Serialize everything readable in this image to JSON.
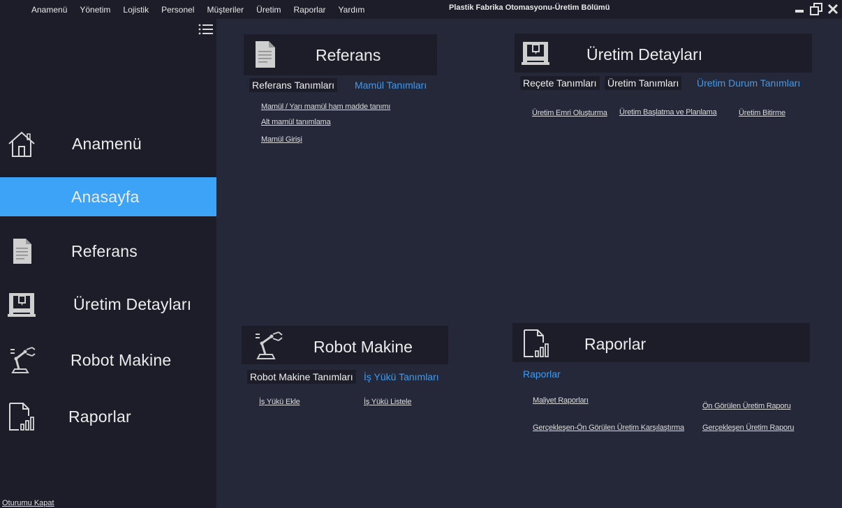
{
  "menu": [
    "Anamenü",
    "Yönetim",
    "Lojistik",
    "Personel",
    "Müşteriler",
    "Üretim",
    "Raporlar",
    "Yardım"
  ],
  "app_title": "Plastik Fabrika Otomasyonu-Üretim Bölümü",
  "window_controls": {
    "minimize": "minimize-icon",
    "restore": "restore-icon",
    "close": "close-icon"
  },
  "colors": {
    "accent": "#3da3f6",
    "sidebar": "#1c1d28",
    "background": "#252838",
    "link_blue": "#3d9bf2"
  },
  "sidebar": {
    "items": [
      {
        "label": "Anamenü",
        "icon": "home-icon"
      },
      {
        "label": "Anasayfa",
        "icon": "",
        "active": true
      },
      {
        "label": "Referans",
        "icon": "document-icon"
      },
      {
        "label": "Üretim Detayları",
        "icon": "3d-printer-icon"
      },
      {
        "label": "Robot Makine",
        "icon": "robot-arm-icon"
      },
      {
        "label": "Raporlar",
        "icon": "report-chart-icon"
      }
    ],
    "logout": "Oturumu Kapat"
  },
  "panels": {
    "referans": {
      "title": "Referans",
      "tabs": [
        "Referans Tanımları",
        "Mamül Tanımları"
      ],
      "links": [
        "Mamül / Yarı mamül ham madde tanımı",
        "Alt mamül tanımlama",
        "Mamül Girişi"
      ]
    },
    "uretim": {
      "title": "Üretim Detayları",
      "tabs": [
        "Reçete Tanımları",
        "Üretim Tanımları",
        "Üretim Durum Tanımları"
      ],
      "links": [
        "Üretim Emri Oluşturma",
        "Üretim Başlatma ve Planlama",
        "Üretim Bitirme"
      ]
    },
    "robot": {
      "title": "Robot Makine",
      "tabs": [
        "Robot Makine Tanımları",
        "İş Yükü Tanımları"
      ],
      "links": [
        "İş Yükü Ekle",
        "İş  Yükü Listele"
      ]
    },
    "raporlar": {
      "title": "Raporlar",
      "tabs": [
        "Raporlar"
      ],
      "links": [
        "Maliyet Raporları",
        "Ön Görülen Üretim Raporu",
        "Gerçekleşen-Ön Görülen Üretim Karşılaştırma",
        "Gerçekleşen Üretim Raporu"
      ]
    }
  }
}
